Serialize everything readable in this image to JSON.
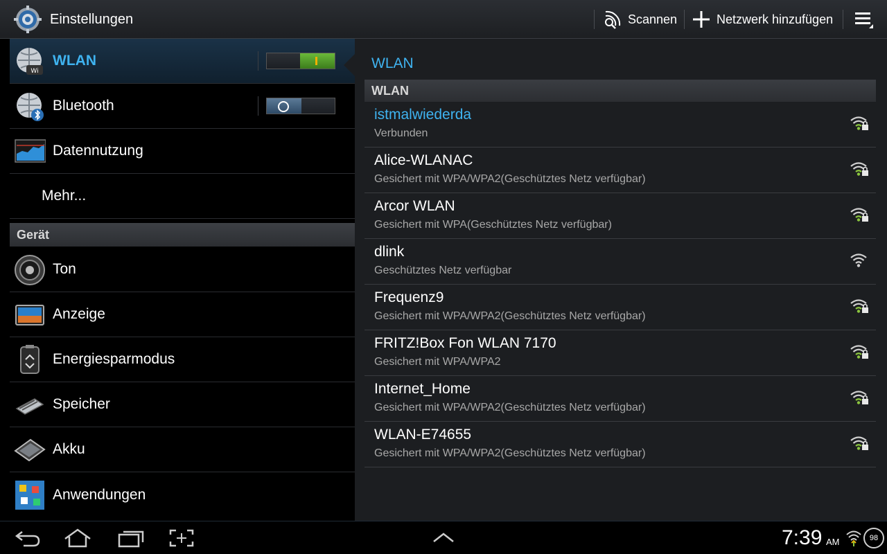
{
  "app": {
    "title": "Einstellungen"
  },
  "actions": {
    "scan_label": "Scannen",
    "add_network_label": "Netzwerk hinzufügen"
  },
  "sidebar": {
    "items": [
      {
        "label": "WLAN",
        "icon": "wlan-globe-icon",
        "toggle": "on",
        "selected": true
      },
      {
        "label": "Bluetooth",
        "icon": "bluetooth-globe-icon",
        "toggle": "off"
      },
      {
        "label": "Datennutzung",
        "icon": "data-usage-icon"
      },
      {
        "label": "Mehr..."
      }
    ],
    "section_device": "Gerät",
    "device_items": [
      {
        "label": "Ton",
        "icon": "speaker-icon"
      },
      {
        "label": "Anzeige",
        "icon": "display-icon"
      },
      {
        "label": "Energiesparmodus",
        "icon": "power-saving-icon"
      },
      {
        "label": "Speicher",
        "icon": "storage-icon"
      },
      {
        "label": "Akku",
        "icon": "battery-icon"
      },
      {
        "label": "Anwendungen",
        "icon": "applications-icon"
      }
    ]
  },
  "detail": {
    "title": "WLAN",
    "section": "WLAN",
    "networks": [
      {
        "ssid": "istmalwiederda",
        "status": "Verbunden",
        "connected": true,
        "secured": true
      },
      {
        "ssid": "Alice-WLANAC",
        "status": "Gesichert mit WPA/WPA2(Geschütztes Netz verfügbar)",
        "secured": true
      },
      {
        "ssid": "Arcor WLAN",
        "status": "Gesichert mit WPA(Geschütztes Netz verfügbar)",
        "secured": true
      },
      {
        "ssid": "dlink",
        "status": "Geschütztes Netz verfügbar",
        "secured": false
      },
      {
        "ssid": "Frequenz9",
        "status": "Gesichert mit WPA/WPA2(Geschütztes Netz verfügbar)",
        "secured": true
      },
      {
        "ssid": "FRITZ!Box Fon WLAN 7170",
        "status": "Gesichert mit WPA/WPA2",
        "secured": true
      },
      {
        "ssid": "Internet_Home",
        "status": "Gesichert mit WPA/WPA2(Geschütztes Netz verfügbar)",
        "secured": true
      },
      {
        "ssid": "WLAN-E74655",
        "status": "Gesichert mit WPA/WPA2(Geschütztes Netz verfügbar)",
        "secured": true
      }
    ]
  },
  "statusbar": {
    "time": "7:39",
    "ampm": "AM",
    "battery": "98"
  },
  "colors": {
    "accent": "#3fb3f0",
    "toggle_on": "#6ab93a",
    "signal_on": "#8bc53f"
  }
}
